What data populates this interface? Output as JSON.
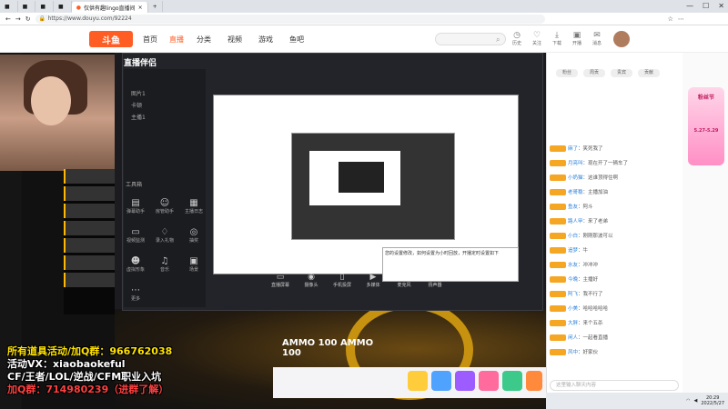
{
  "browser": {
    "tabs": [
      {
        "label": "",
        "active": false
      },
      {
        "label": "",
        "active": false
      },
      {
        "label": "",
        "active": false
      },
      {
        "label": "",
        "active": false
      },
      {
        "label": "仅供有趣lingo直播间",
        "active": true
      }
    ],
    "url": "https://www.douyu.com/92224"
  },
  "site": {
    "logo": "斗鱼",
    "nav": [
      "首页",
      "直播",
      "分类",
      "视频",
      "游戏",
      "鱼吧"
    ],
    "active_nav": "直播",
    "search_placeholder": "",
    "header_icons": [
      "历史",
      "关注",
      "下载",
      "开播",
      "消息"
    ]
  },
  "app": {
    "title": "直播伴侣",
    "version": "",
    "sidebar": [
      "图片1",
      "卡顿",
      "主播1"
    ],
    "section_label": "工具箱",
    "tools": [
      "弹幕助手",
      "房管助手",
      "主播日志",
      "视频监测",
      "录入礼物",
      "抽奖",
      "虚拟形象",
      "音乐",
      "场景",
      "更多"
    ],
    "bottom_buttons": [
      "直播屏幕",
      "摄像头",
      "手机投屏",
      "多媒体",
      "麦克风",
      "扬声器"
    ],
    "tooltip": "您的设置修改，如何设置为小时回放，开播定时设置如下"
  },
  "overlay": {
    "line1": "所有道具活动/加Q群：966762038",
    "line2": "活动VX：xiaobaokeful",
    "line3": "CF/王者/LOL/逆战/CFM职业入坑",
    "line4": "加Q群：714980239（进群了解）"
  },
  "hud": {
    "ammo": "100",
    "ammo2": "100"
  },
  "chat": {
    "tabs": [
      "粉丝",
      "周贡",
      "贵宾",
      "贡献"
    ],
    "messages": [
      {
        "user": "麻了",
        "text": "笑死我了"
      },
      {
        "user": "月亮叫",
        "text": "现在开了一辆车了"
      },
      {
        "user": "小奶猫",
        "text": "这谁顶得住啊"
      },
      {
        "user": "老哥稳",
        "text": "主播加油"
      },
      {
        "user": "鱼友",
        "text": "阿斗"
      },
      {
        "user": "路人甲",
        "text": "来了老弟"
      },
      {
        "user": "小白",
        "text": "刚刚那波可以"
      },
      {
        "user": "追梦",
        "text": "牛"
      },
      {
        "user": "水友",
        "text": "冲冲冲"
      },
      {
        "user": "今晚",
        "text": "主播好"
      },
      {
        "user": "阿飞",
        "text": "我不行了"
      },
      {
        "user": "小美",
        "text": "哈哈哈哈哈"
      },
      {
        "user": "大胖",
        "text": "来个五杀"
      },
      {
        "user": "闲人",
        "text": "一起看直播"
      },
      {
        "user": "风中",
        "text": "好家伙"
      }
    ],
    "input_placeholder": "这里输入聊天内容",
    "send": "发送"
  },
  "promo": {
    "text": "粉丝节",
    "date": "5.27-5.29"
  },
  "taskbar": {
    "time": "20:29",
    "date": "2022/5/27"
  }
}
